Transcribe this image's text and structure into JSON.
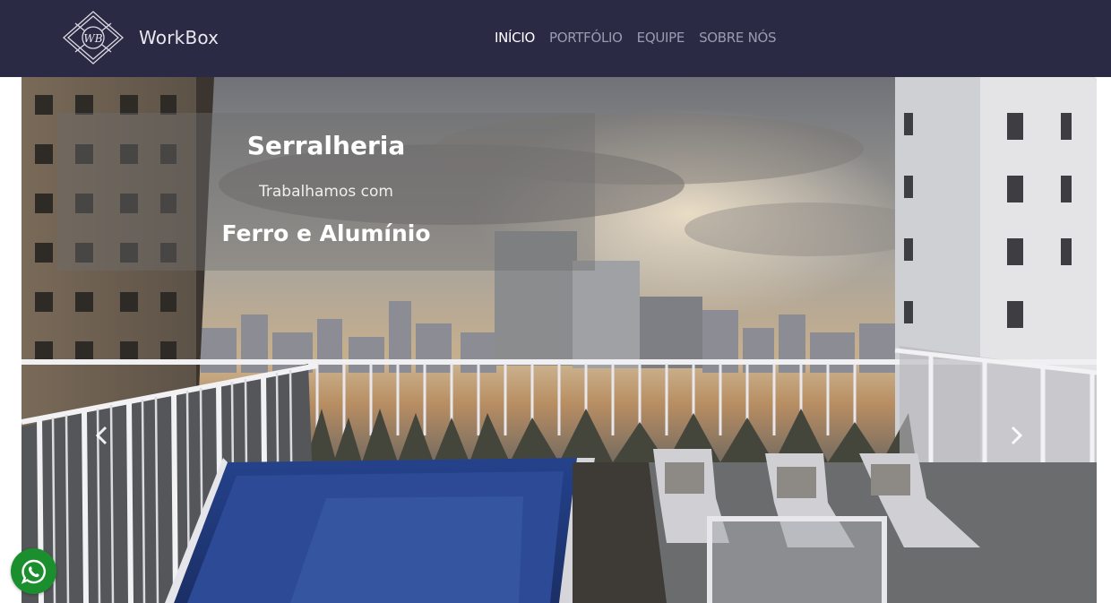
{
  "brand": {
    "name": "WorkBox",
    "logo_icon": "wb-diamond-logo-icon",
    "logo_letters": "WB"
  },
  "nav": {
    "items": [
      {
        "label": "INÍCIO",
        "active": true
      },
      {
        "label": "PORTFÓLIO",
        "active": false
      },
      {
        "label": "EQUIPE",
        "active": false
      },
      {
        "label": "SOBRE NÓS",
        "active": false
      }
    ]
  },
  "carousel": {
    "caption": {
      "title": "Serralheria",
      "subtitle": "Trabalhamos com",
      "highlight": "Ferro e Alumínio"
    },
    "prev_icon": "chevron-left-icon",
    "next_icon": "chevron-right-icon"
  },
  "whatsapp": {
    "icon": "whatsapp-icon"
  },
  "colors": {
    "navbar": "#2b2a44",
    "nav_inactive": "#9b9bb0",
    "nav_active": "#ffffff",
    "whatsapp": "#1b8f2e"
  }
}
